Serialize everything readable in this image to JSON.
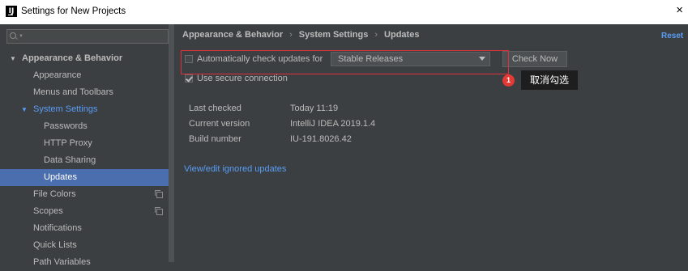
{
  "window": {
    "title": "Settings for New Projects",
    "close_glyph": "×"
  },
  "search": {
    "placeholder": ""
  },
  "sidebar": {
    "items": [
      {
        "label": "Appearance & Behavior"
      },
      {
        "label": "Appearance"
      },
      {
        "label": "Menus and Toolbars"
      },
      {
        "label": "System Settings"
      },
      {
        "label": "Passwords"
      },
      {
        "label": "HTTP Proxy"
      },
      {
        "label": "Data Sharing"
      },
      {
        "label": "Updates"
      },
      {
        "label": "File Colors"
      },
      {
        "label": "Scopes"
      },
      {
        "label": "Notifications"
      },
      {
        "label": "Quick Lists"
      },
      {
        "label": "Path Variables"
      }
    ],
    "selected": "Updates"
  },
  "breadcrumb": {
    "items": [
      "Appearance & Behavior",
      "System Settings",
      "Updates"
    ],
    "separator": "›"
  },
  "reset_label": "Reset",
  "updates": {
    "auto_check_label": "Automatically check updates for",
    "auto_check_checked": false,
    "channel_value": "Stable Releases",
    "check_now_label": "Check Now",
    "secure_label": "Use secure connection",
    "secure_checked": true
  },
  "annotation": {
    "number": "1",
    "text": "取消勾选"
  },
  "info": {
    "last_checked_label": "Last checked",
    "last_checked_value": "Today 11:19",
    "current_version_label": "Current version",
    "current_version_value": "IntelliJ IDEA 2019.1.4",
    "build_number_label": "Build number",
    "build_number_value": "IU-191.8026.42"
  },
  "ignored_updates_link": "View/edit ignored updates",
  "colors": {
    "background": "#3c3f41",
    "selection": "#4b6eaf",
    "link": "#589df6",
    "annotation_red": "#e0303a"
  }
}
